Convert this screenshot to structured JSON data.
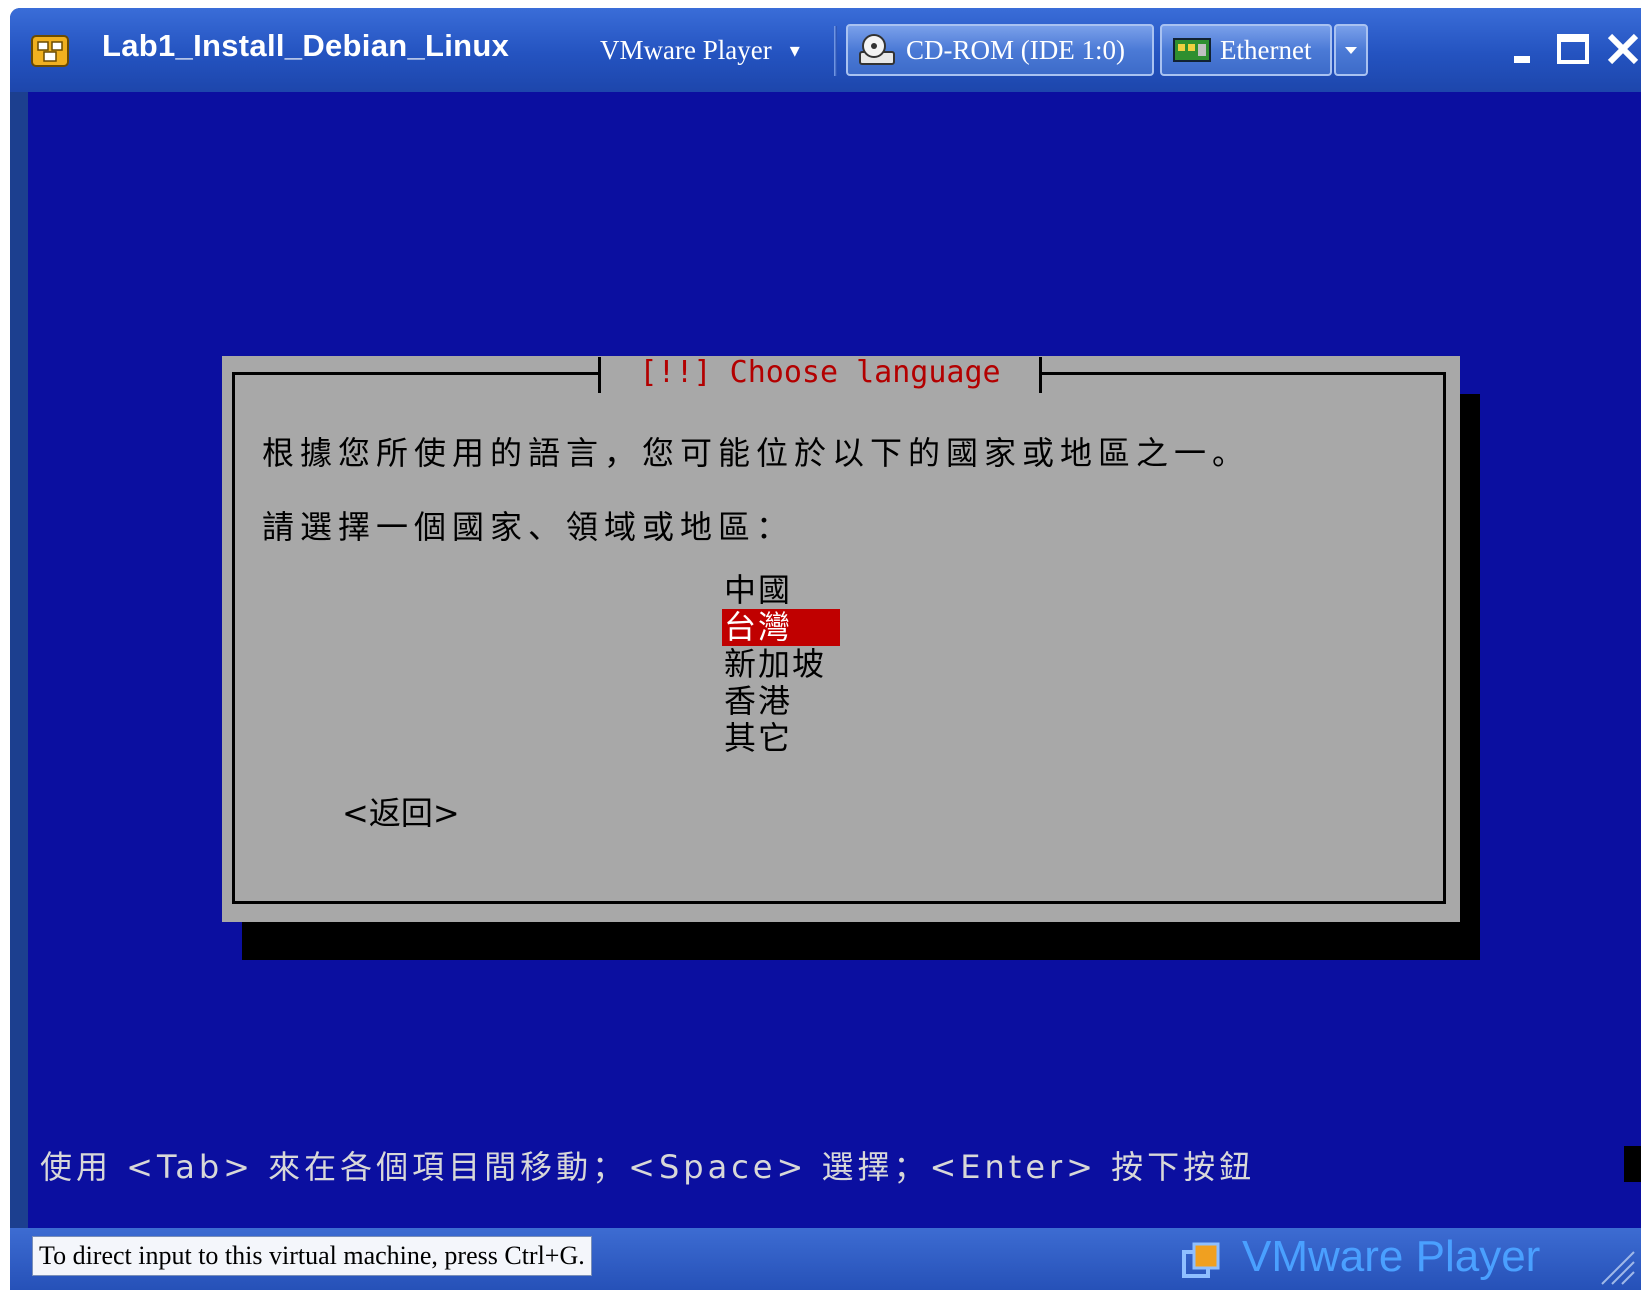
{
  "window": {
    "title": "Lab1_Install_Debian_Linux",
    "menu_label": "VMware Player",
    "menu_arrow": "▾",
    "devices": [
      {
        "label": "CD-ROM (IDE 1:0)",
        "icon": "cdrom-icon"
      },
      {
        "label": "Ethernet",
        "icon": "network-adapter-icon"
      }
    ],
    "controls": [
      "minimize",
      "maximize",
      "close"
    ]
  },
  "installer": {
    "dialog_title": "[!!] Choose language",
    "prompt_line1": "根據您所使用的語言，您可能位於以下的國家或地區之一。",
    "prompt_line2": "請選擇一個國家、領域或地區：",
    "countries": [
      "中國",
      "台灣",
      "新加坡",
      "香港",
      "其它"
    ],
    "selected_country": "台灣",
    "back_button": "<返回>",
    "help_line": "使用 <Tab> 來在各個項目間移動；<Space> 選擇；<Enter> 按下按鈕"
  },
  "statusbar": {
    "message": "To direct input to this virtual machine, press Ctrl+G.",
    "brand": "VMware Player"
  },
  "colors": {
    "screen_bg": "#0b0fa0",
    "dialog_bg": "#a8a8a8",
    "title_red": "#b30000",
    "selection_bg": "#c00000",
    "titlebar_blue": "#2453c0"
  }
}
